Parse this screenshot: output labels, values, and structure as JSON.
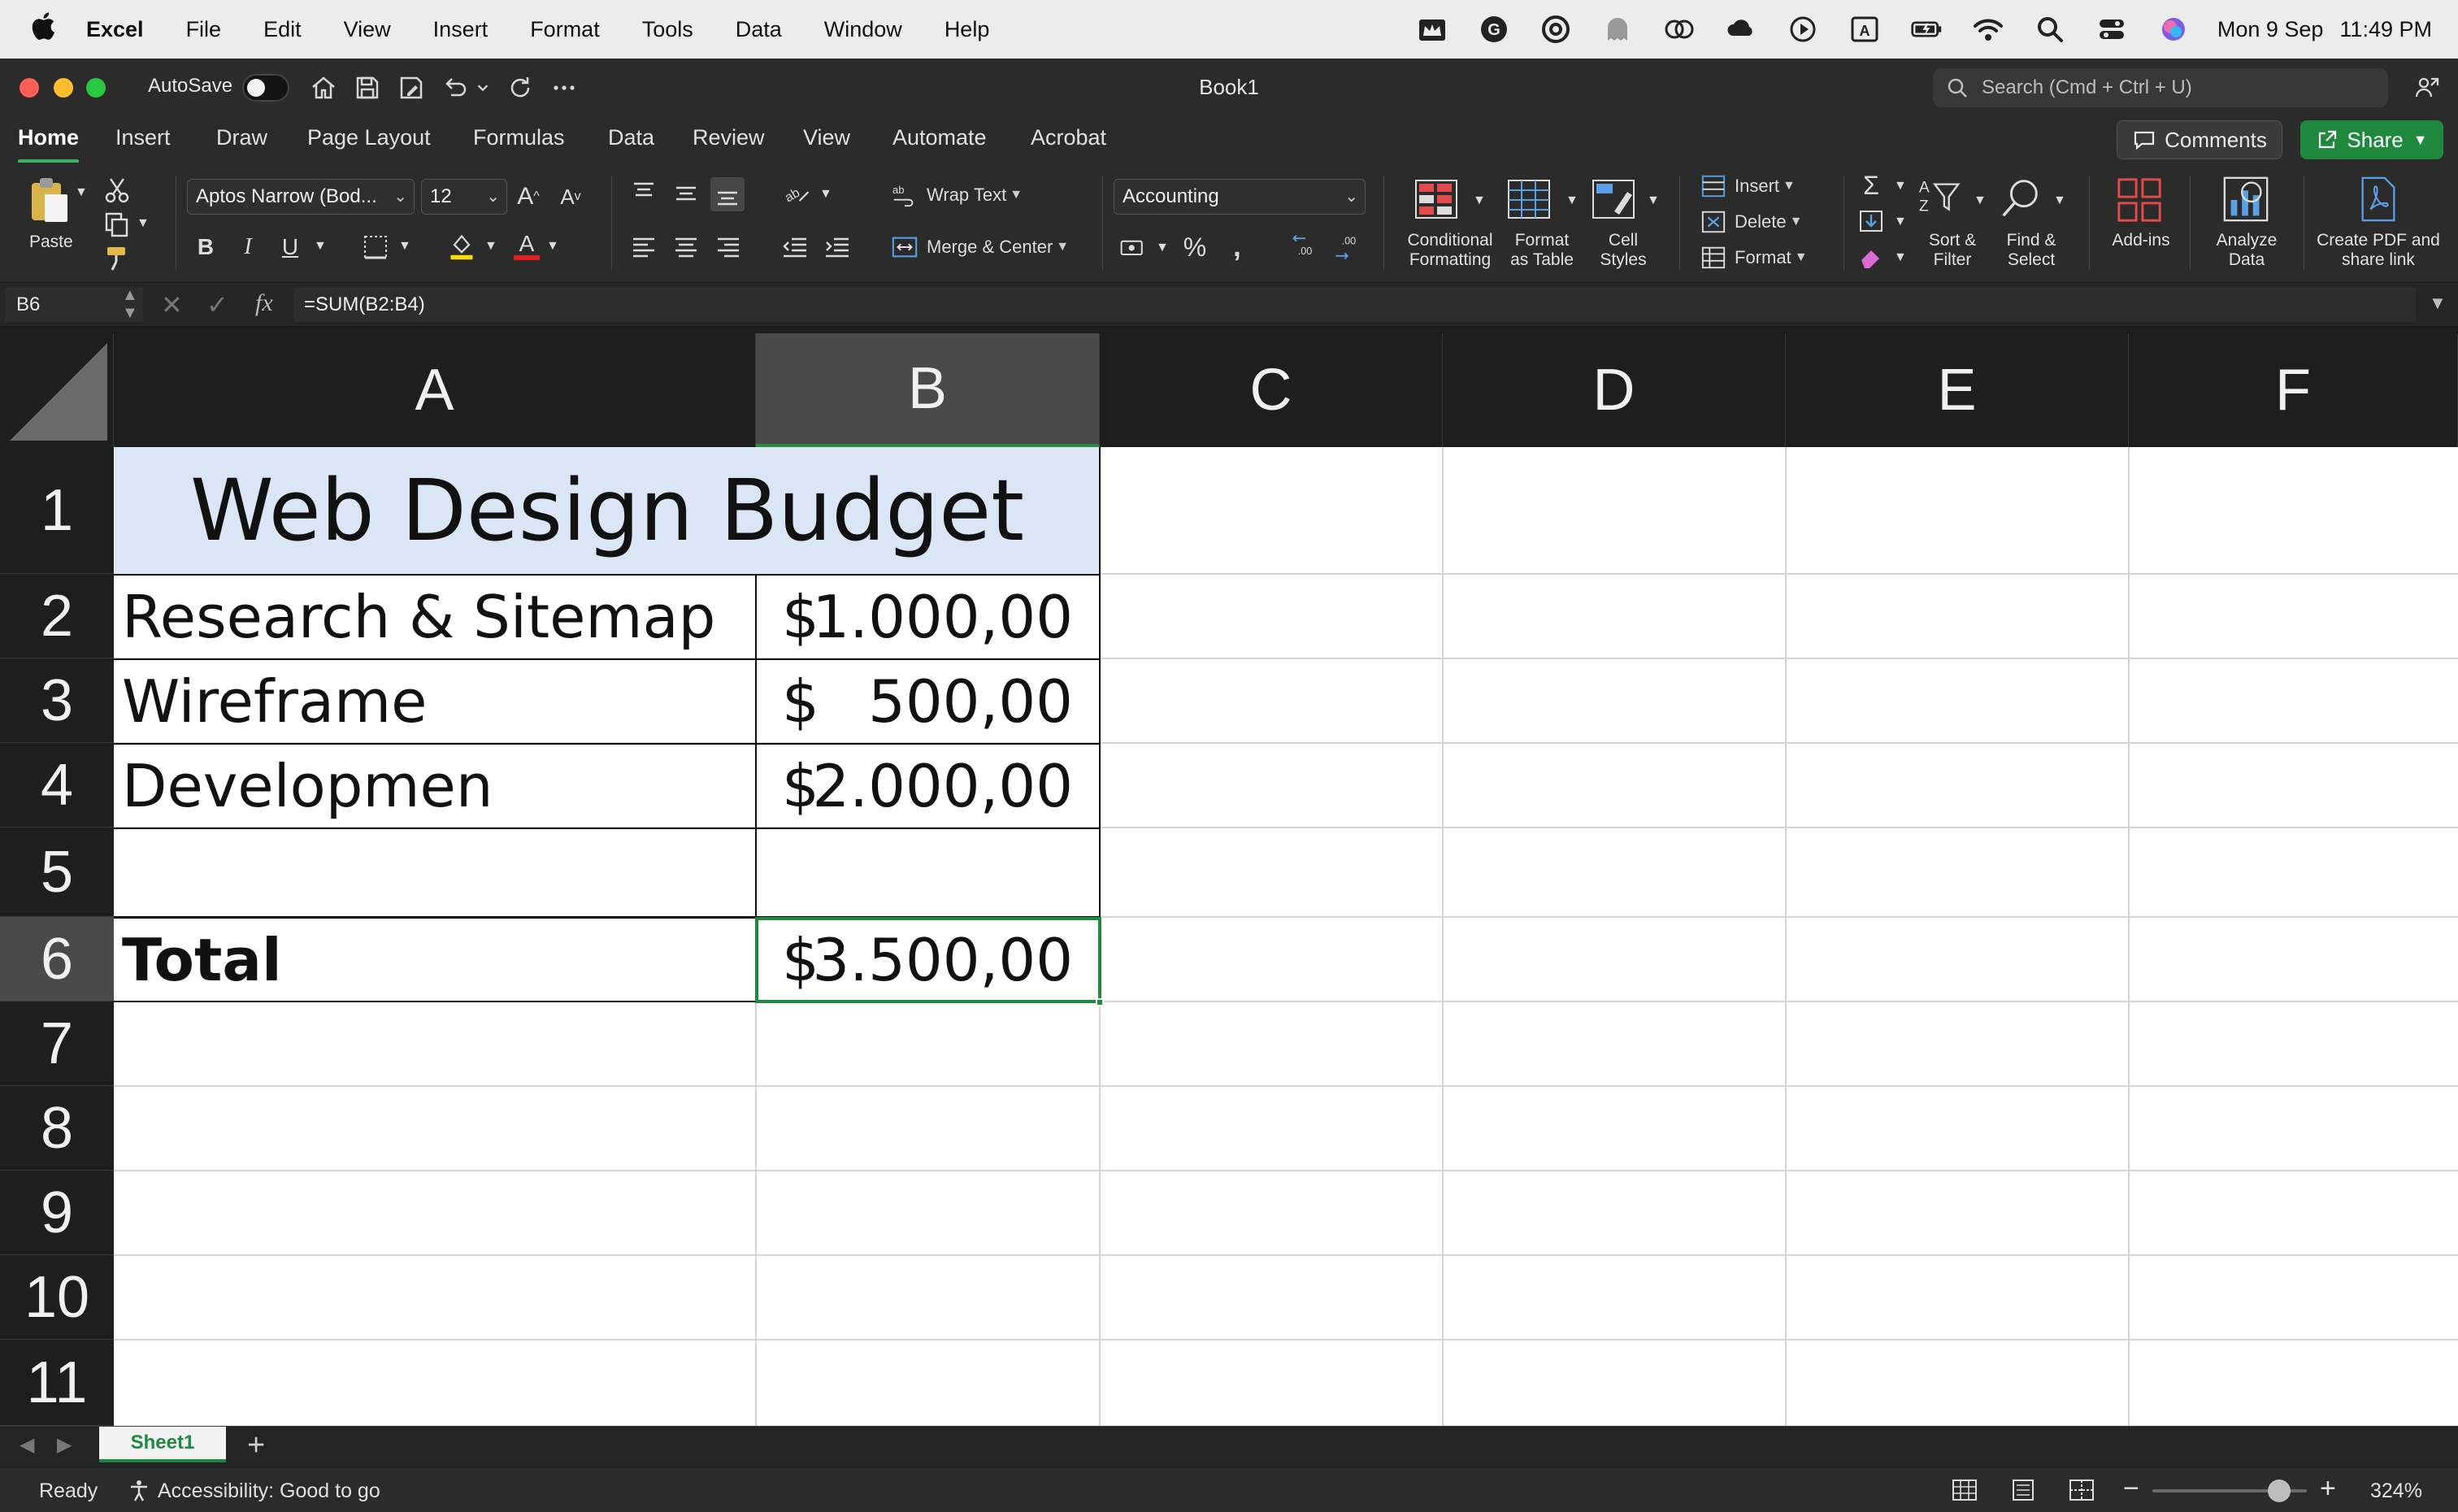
{
  "menubar": {
    "app_name": "Excel",
    "menus": [
      "File",
      "Edit",
      "View",
      "Insert",
      "Format",
      "Tools",
      "Data",
      "Window",
      "Help"
    ],
    "date": "Mon 9 Sep",
    "time": "11:49 PM"
  },
  "window": {
    "title": "Book1",
    "autosave_label": "AutoSave",
    "search_placeholder": "Search (Cmd + Ctrl + U)"
  },
  "ribbon_tabs": [
    "Home",
    "Insert",
    "Draw",
    "Page Layout",
    "Formulas",
    "Data",
    "Review",
    "View",
    "Automate",
    "Acrobat"
  ],
  "ribbon_actions": {
    "comments": "Comments",
    "share": "Share"
  },
  "ribbon": {
    "paste": "Paste",
    "font_name": "Aptos Narrow (Bod...",
    "font_size": "12",
    "wrap_text": "Wrap Text",
    "merge_center": "Merge & Center",
    "number_format": "Accounting",
    "conditional_formatting": "Conditional Formatting",
    "format_as_table": "Format as Table",
    "cell_styles": "Cell Styles",
    "insert": "Insert",
    "delete": "Delete",
    "format": "Format",
    "sort_filter": "Sort & Filter",
    "find_select": "Find & Select",
    "add_ins": "Add-ins",
    "analyze_data": "Analyze Data",
    "create_pdf": "Create PDF and share link"
  },
  "formula_bar": {
    "cell_ref": "B6",
    "fx": "fx",
    "formula": "=SUM(B2:B4)"
  },
  "grid": {
    "columns": [
      "A",
      "B",
      "C",
      "D",
      "E",
      "F"
    ],
    "rows": [
      "1",
      "2",
      "3",
      "4",
      "5",
      "6",
      "7",
      "8",
      "9",
      "10",
      "11"
    ],
    "title": "Web Design Budget",
    "items": [
      {
        "label": "Research & Sitemap",
        "currency": "$",
        "amount": "1.000,00"
      },
      {
        "label": "Wireframe",
        "currency": "$",
        "amount": "500,00"
      },
      {
        "label": "Developmen",
        "currency": "$",
        "amount": "2.000,00"
      }
    ],
    "total": {
      "label": "Total",
      "currency": "$",
      "amount": "3.500,00"
    }
  },
  "sheets": [
    "Sheet1"
  ],
  "status": {
    "ready": "Ready",
    "accessibility": "Accessibility: Good to go",
    "zoom": "324%"
  },
  "colors": {
    "accent_green": "#1f8a3e",
    "title_fill": "#dae6f6"
  }
}
